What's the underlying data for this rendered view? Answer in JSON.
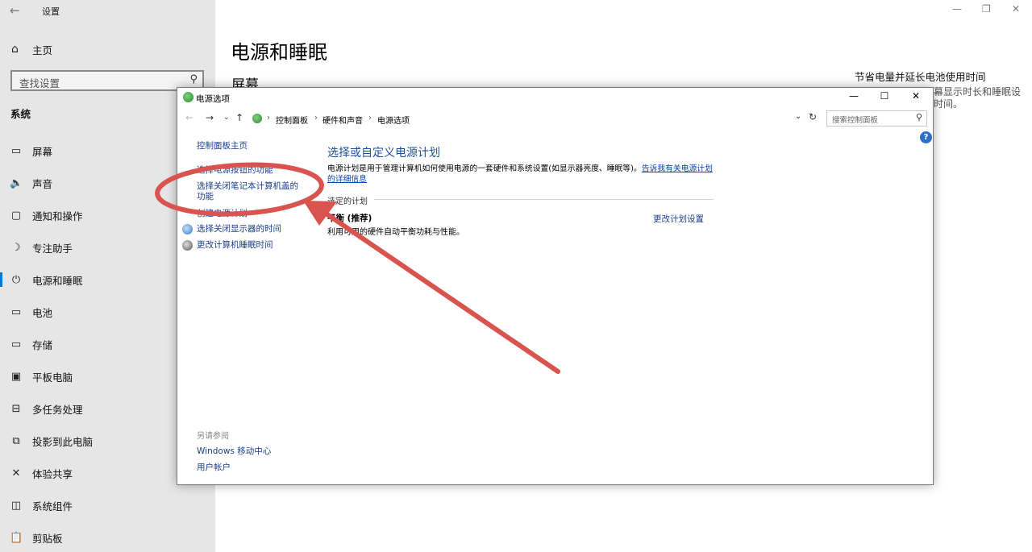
{
  "settings": {
    "window_title": "设置",
    "home_label": "主页",
    "search_placeholder": "查找设置",
    "section_title": "系统",
    "nav_items": [
      {
        "label": "屏幕"
      },
      {
        "label": "声音"
      },
      {
        "label": "通知和操作"
      },
      {
        "label": "专注助手"
      },
      {
        "label": "电源和睡眠"
      },
      {
        "label": "电池"
      },
      {
        "label": "存储"
      },
      {
        "label": "平板电脑"
      },
      {
        "label": "多任务处理"
      },
      {
        "label": "投影到此电脑"
      },
      {
        "label": "体验共享"
      },
      {
        "label": "系统组件"
      },
      {
        "label": "剪贴板"
      }
    ],
    "active_item": "电源和睡眠",
    "page_heading": "电源和睡眠",
    "page_subheading": "屏幕",
    "right_panel_title": "节省电量并延长电池使用时间",
    "right_panel_text": "幕显示时长和睡眠设\n时间。",
    "win_minimize": "—",
    "win_maximize": "❐",
    "win_close": "✕"
  },
  "power_dialog": {
    "title": "电源选项",
    "title_minimize": "—",
    "title_maximize": "☐",
    "title_close": "✕",
    "breadcrumb": [
      "控制面板",
      "硬件和声音",
      "电源选项"
    ],
    "search_placeholder": "搜索控制面板",
    "help_label": "?",
    "left_links": [
      "控制面板主页",
      "选择电源按钮的功能",
      "选择关闭笔记本计算机盖的功能",
      "创建电源计划",
      "选择关闭显示器的时间",
      "更改计算机睡眠时间"
    ],
    "see_also": "另请参阅",
    "bottom_links": [
      "Windows 移动中心",
      "用户帐户"
    ],
    "main_title": "选择或自定义电源计划",
    "main_desc": "电源计划是用于管理计算机如何使用电源的一套硬件和系统设置(如显示器亮度、睡眠等)。",
    "main_desc_link": "告诉我有关电源计划的详细信息",
    "plans_header": "选定的计划",
    "plan_name": "平衡 (推荐)",
    "plan_desc": "利用可用的硬件自动平衡功耗与性能。",
    "plan_settings_link": "更改计划设置"
  },
  "colors": {
    "accent": "#0078d7",
    "link": "#1c3e8a",
    "annotation": "#d9534f"
  }
}
